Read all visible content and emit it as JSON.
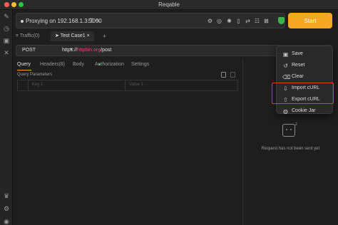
{
  "window": {
    "title": "Reqable"
  },
  "proxy": {
    "status_text": "Proxying on 192.168.1.3:9000"
  },
  "start_button": {
    "label": "Start"
  },
  "tabs": [
    {
      "label": "Traffic(0)"
    },
    {
      "label": "Test Case1"
    },
    {
      "label": "+"
    }
  ],
  "request": {
    "method": "POST",
    "url_prefix": "https://",
    "url_host": "httpbin.org",
    "url_path": "/post"
  },
  "subtabs": [
    {
      "label": "Query"
    },
    {
      "label": "Headers(8)"
    },
    {
      "label": "Body"
    },
    {
      "label": "Authorization"
    },
    {
      "label": "Settings"
    }
  ],
  "query_params": {
    "label": "Query Parameters",
    "key_placeholder": "Key 1",
    "value_placeholder": "Value 1"
  },
  "menu": {
    "items": [
      {
        "label": "Save",
        "icon": "save-icon"
      },
      {
        "label": "Reset",
        "icon": "reset-icon"
      },
      {
        "label": "Clear",
        "icon": "clear-icon"
      },
      {
        "label": "Import cURL",
        "icon": "import-icon"
      },
      {
        "label": "Export cURL",
        "icon": "export-icon"
      },
      {
        "label": "Cookie Jar",
        "icon": "cookie-icon"
      }
    ]
  },
  "empty_state": {
    "text": "Request has not been sent yet",
    "badge": "z"
  },
  "colors": {
    "accent": "#f5a623",
    "highlight": "#e53935",
    "host": "#e0457b",
    "shield": "#3bb54a"
  }
}
